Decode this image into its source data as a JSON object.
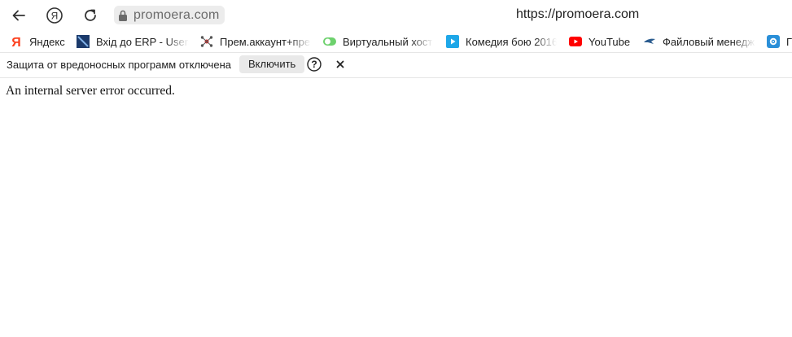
{
  "toolbar": {
    "back_icon": "back-arrow-icon",
    "yandex_icon": "yandex-logo-icon",
    "reload_icon": "reload-icon",
    "lock_icon": "lock-icon",
    "address_domain": "promoera.com",
    "page_url": "https://promoera.com"
  },
  "bookmarks": [
    {
      "label": "Яндекс",
      "icon": "yandex-y-icon"
    },
    {
      "label": "Вхід до ERP - Users",
      "icon": "erp-icon"
    },
    {
      "label": "Прем.аккаунт+пре",
      "icon": "network-icon"
    },
    {
      "label": "Виртуальный хост",
      "icon": "toggle-icon"
    },
    {
      "label": "Комедия бою 2016",
      "icon": "video-icon"
    },
    {
      "label": "YouTube",
      "icon": "youtube-icon"
    },
    {
      "label": "Файловый менедж",
      "icon": "bird-icon"
    },
    {
      "label": "Г",
      "icon": "gear-icon"
    }
  ],
  "notice": {
    "text": "Защита от вредоносных программ отключена",
    "button": "Включить",
    "help_icon": "help-icon",
    "close_icon": "close-icon"
  },
  "page": {
    "message": "An internal server error occurred."
  },
  "colors": {
    "youtube": "#ff0000",
    "yandex": "#fc3f1d",
    "toggle": "#6dd16d",
    "video": "#1ea7e8",
    "gear": "#2a8fd8"
  }
}
